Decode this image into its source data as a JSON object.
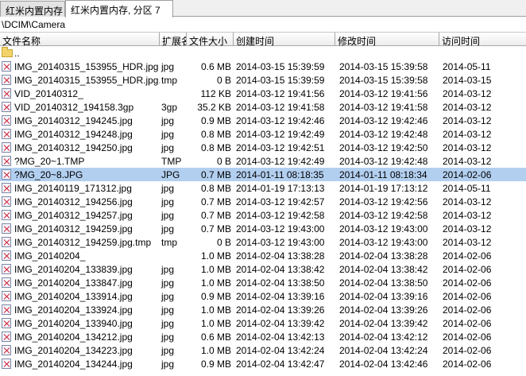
{
  "tabs": [
    {
      "label": "红米内置内存"
    },
    {
      "label": "红米内置内存, 分区 7"
    }
  ],
  "path": "\\DCIM\\Camera",
  "columns": {
    "name": "文件名称",
    "ext": "扩展名",
    "size": "文件大小",
    "ctime": "创建时间",
    "mtime": "修改时间",
    "atime": "访问时间"
  },
  "parent": {
    "name": ".."
  },
  "files": [
    {
      "name": "IMG_20140315_153955_HDR.jpg",
      "ext": "jpg",
      "size": "0.6 MB",
      "ctime": "2014-03-15  15:39:59",
      "mtime": "2014-03-15  15:39:58",
      "atime": "2014-05-11"
    },
    {
      "name": "IMG_20140315_153955_HDR.jpg.tmp",
      "ext": "tmp",
      "size": "0 B",
      "ctime": "2014-03-15  15:39:59",
      "mtime": "2014-03-15  15:39:58",
      "atime": "2014-03-15"
    },
    {
      "name": "VID_20140312_",
      "ext": "",
      "size": "112 KB",
      "ctime": "2014-03-12  19:41:56",
      "mtime": "2014-03-12  19:41:56",
      "atime": "2014-03-12"
    },
    {
      "name": "VID_20140312_194158.3gp",
      "ext": "3gp",
      "size": "35.2 KB",
      "ctime": "2014-03-12  19:41:58",
      "mtime": "2014-03-12  19:41:58",
      "atime": "2014-03-12"
    },
    {
      "name": "IMG_20140312_194245.jpg",
      "ext": "jpg",
      "size": "0.9 MB",
      "ctime": "2014-03-12  19:42:46",
      "mtime": "2014-03-12  19:42:46",
      "atime": "2014-03-12"
    },
    {
      "name": "IMG_20140312_194248.jpg",
      "ext": "jpg",
      "size": "0.8 MB",
      "ctime": "2014-03-12  19:42:49",
      "mtime": "2014-03-12  19:42:48",
      "atime": "2014-03-12"
    },
    {
      "name": "IMG_20140312_194250.jpg",
      "ext": "jpg",
      "size": "0.8 MB",
      "ctime": "2014-03-12  19:42:51",
      "mtime": "2014-03-12  19:42:50",
      "atime": "2014-03-12"
    },
    {
      "name": "?MG_20~1.TMP",
      "ext": "TMP",
      "size": "0 B",
      "ctime": "2014-03-12  19:42:49",
      "mtime": "2014-03-12  19:42:48",
      "atime": "2014-03-12"
    },
    {
      "name": "?MG_20~8.JPG",
      "ext": "JPG",
      "size": "0.7 MB",
      "ctime": "2014-01-11  08:18:35",
      "mtime": "2014-01-11  08:18:34",
      "atime": "2014-02-06",
      "selected": true
    },
    {
      "name": "IMG_20140119_171312.jpg",
      "ext": "jpg",
      "size": "0.8 MB",
      "ctime": "2014-01-19  17:13:13",
      "mtime": "2014-01-19  17:13:12",
      "atime": "2014-05-11"
    },
    {
      "name": "IMG_20140312_194256.jpg",
      "ext": "jpg",
      "size": "0.7 MB",
      "ctime": "2014-03-12  19:42:57",
      "mtime": "2014-03-12  19:42:56",
      "atime": "2014-03-12"
    },
    {
      "name": "IMG_20140312_194257.jpg",
      "ext": "jpg",
      "size": "0.7 MB",
      "ctime": "2014-03-12  19:42:58",
      "mtime": "2014-03-12  19:42:58",
      "atime": "2014-03-12"
    },
    {
      "name": "IMG_20140312_194259.jpg",
      "ext": "jpg",
      "size": "0.7 MB",
      "ctime": "2014-03-12  19:43:00",
      "mtime": "2014-03-12  19:43:00",
      "atime": "2014-03-12"
    },
    {
      "name": "IMG_20140312_194259.jpg.tmp",
      "ext": "tmp",
      "size": "0 B",
      "ctime": "2014-03-12  19:43:00",
      "mtime": "2014-03-12  19:43:00",
      "atime": "2014-03-12"
    },
    {
      "name": "IMG_20140204_",
      "ext": "",
      "size": "1.0 MB",
      "ctime": "2014-02-04  13:38:28",
      "mtime": "2014-02-04  13:38:28",
      "atime": "2014-02-06"
    },
    {
      "name": "IMG_20140204_133839.jpg",
      "ext": "jpg",
      "size": "1.0 MB",
      "ctime": "2014-02-04  13:38:42",
      "mtime": "2014-02-04  13:38:42",
      "atime": "2014-02-06"
    },
    {
      "name": "IMG_20140204_133847.jpg",
      "ext": "jpg",
      "size": "1.0 MB",
      "ctime": "2014-02-04  13:38:50",
      "mtime": "2014-02-04  13:38:50",
      "atime": "2014-02-06"
    },
    {
      "name": "IMG_20140204_133914.jpg",
      "ext": "jpg",
      "size": "0.9 MB",
      "ctime": "2014-02-04  13:39:16",
      "mtime": "2014-02-04  13:39:16",
      "atime": "2014-02-06"
    },
    {
      "name": "IMG_20140204_133924.jpg",
      "ext": "jpg",
      "size": "1.0 MB",
      "ctime": "2014-02-04  13:39:26",
      "mtime": "2014-02-04  13:39:26",
      "atime": "2014-02-06"
    },
    {
      "name": "IMG_20140204_133940.jpg",
      "ext": "jpg",
      "size": "1.0 MB",
      "ctime": "2014-02-04  13:39:42",
      "mtime": "2014-02-04  13:39:42",
      "atime": "2014-02-06"
    },
    {
      "name": "IMG_20140204_134212.jpg",
      "ext": "jpg",
      "size": "0.6 MB",
      "ctime": "2014-02-04  13:42:13",
      "mtime": "2014-02-04  13:42:12",
      "atime": "2014-02-06"
    },
    {
      "name": "IMG_20140204_134223.jpg",
      "ext": "jpg",
      "size": "1.0 MB",
      "ctime": "2014-02-04  13:42:24",
      "mtime": "2014-02-04  13:42:24",
      "atime": "2014-02-06"
    },
    {
      "name": "IMG_20140204_134244.jpg",
      "ext": "jpg",
      "size": "0.9 MB",
      "ctime": "2014-02-04  13:42:47",
      "mtime": "2014-02-04  13:42:46",
      "atime": "2014-02-06"
    }
  ],
  "colors": {
    "selection": "#b3cff0",
    "icon_mark": "#d0203a",
    "folder": "#f2d36b"
  }
}
